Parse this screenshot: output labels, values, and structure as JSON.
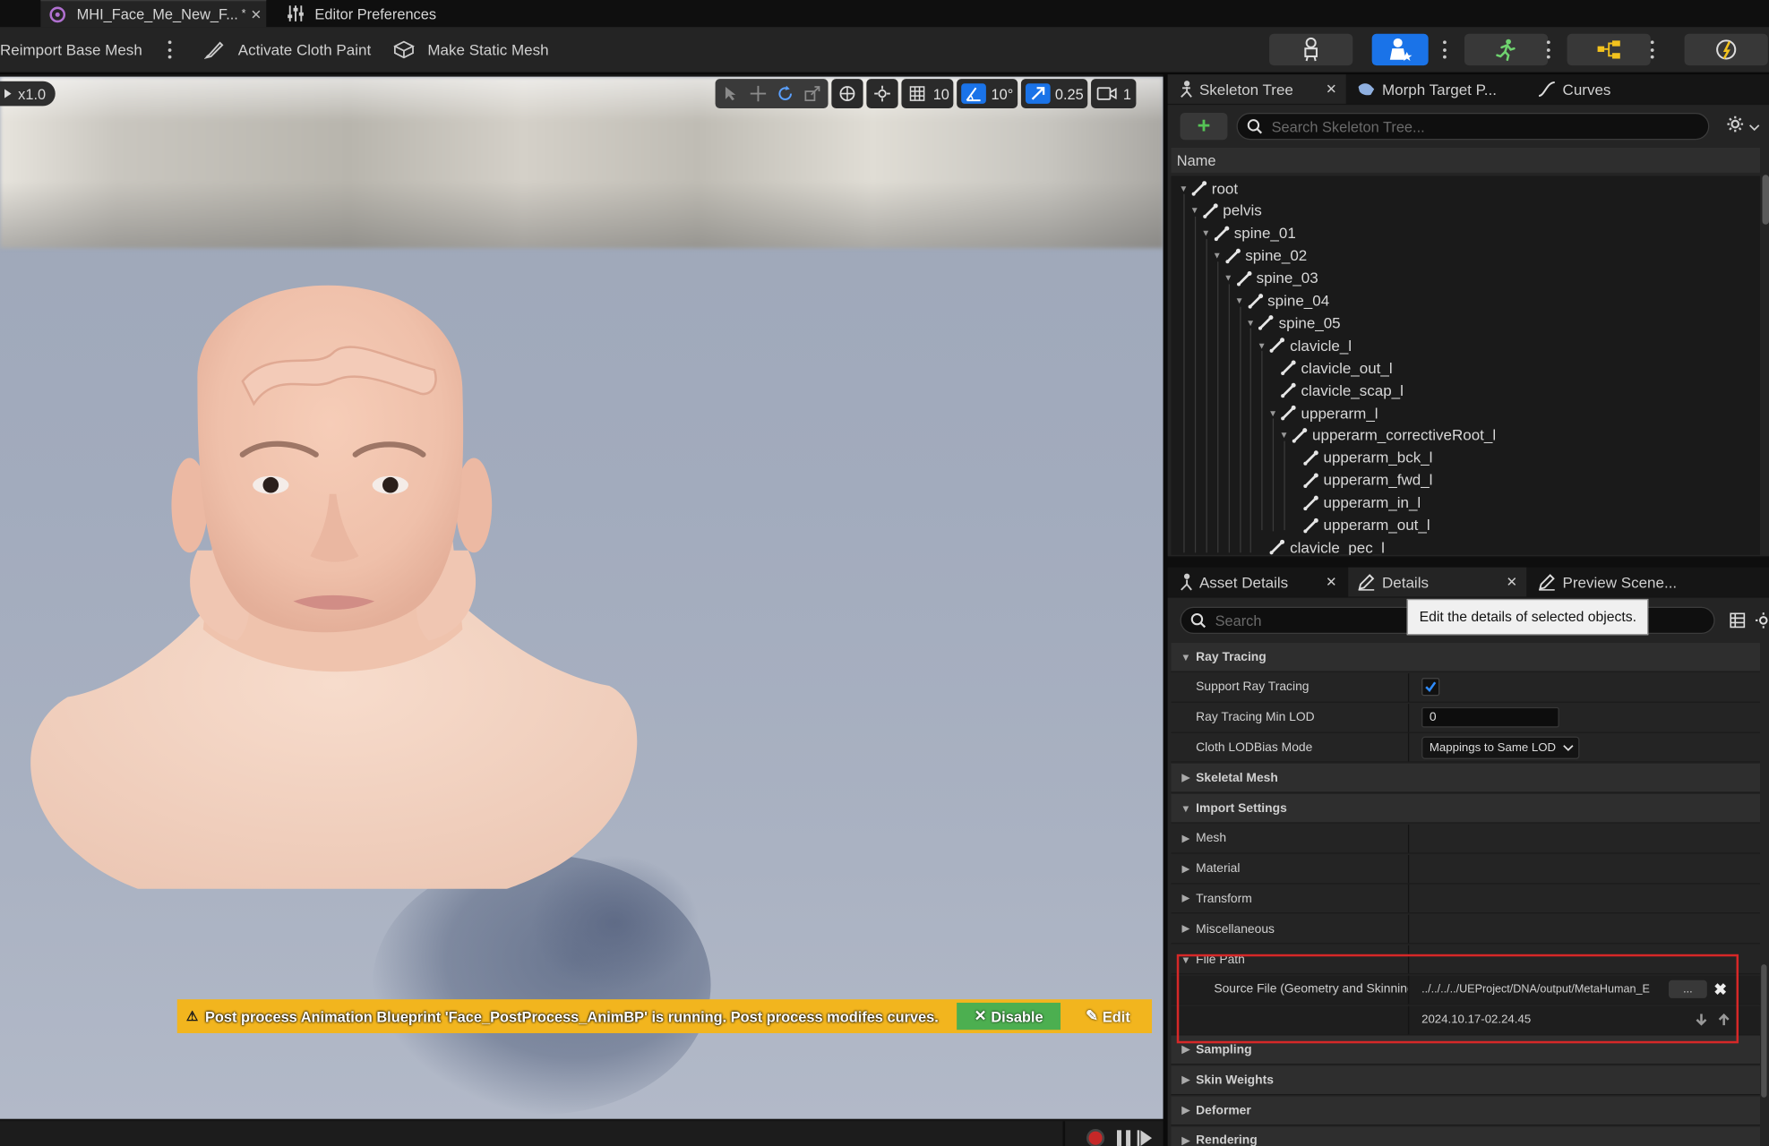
{
  "tabs": [
    {
      "label": "MHI_Face_Me_New_F...",
      "dirty": "*",
      "close": "✕"
    },
    {
      "label": "Editor Preferences"
    }
  ],
  "toolbar": {
    "reimport_label": "Reimport Base Mesh",
    "cloth_paint_label": "Activate Cloth Paint",
    "static_mesh_label": "Make Static Mesh"
  },
  "viewport": {
    "speed": "x1.0",
    "grid_snap": "10",
    "rotation_snap": "10°",
    "scale_snap": "0.25",
    "camera_speed": "1"
  },
  "notification": {
    "text": "Post process Animation Blueprint 'Face_PostProcess_AnimBP' is running. Post process modifes curves.",
    "disable_label": "Disable",
    "edit_label": "Edit"
  },
  "skeleton_panel": {
    "tabs": [
      "Skeleton Tree",
      "Morph Target P...",
      "Curves"
    ],
    "search_placeholder": "Search Skeleton Tree...",
    "column_name": "Name",
    "bones": [
      {
        "name": "root",
        "depth": 0,
        "expanded": true
      },
      {
        "name": "pelvis",
        "depth": 1,
        "expanded": true
      },
      {
        "name": "spine_01",
        "depth": 2,
        "expanded": true
      },
      {
        "name": "spine_02",
        "depth": 3,
        "expanded": true
      },
      {
        "name": "spine_03",
        "depth": 4,
        "expanded": true
      },
      {
        "name": "spine_04",
        "depth": 5,
        "expanded": true
      },
      {
        "name": "spine_05",
        "depth": 6,
        "expanded": true
      },
      {
        "name": "clavicle_l",
        "depth": 7,
        "expanded": true
      },
      {
        "name": "clavicle_out_l",
        "depth": 8,
        "expanded": false
      },
      {
        "name": "clavicle_scap_l",
        "depth": 8,
        "expanded": false
      },
      {
        "name": "upperarm_l",
        "depth": 8,
        "expanded": true
      },
      {
        "name": "upperarm_correctiveRoot_l",
        "depth": 9,
        "expanded": true
      },
      {
        "name": "upperarm_bck_l",
        "depth": 10,
        "expanded": false
      },
      {
        "name": "upperarm_fwd_l",
        "depth": 10,
        "expanded": false
      },
      {
        "name": "upperarm_in_l",
        "depth": 10,
        "expanded": false
      },
      {
        "name": "upperarm_out_l",
        "depth": 10,
        "expanded": false
      },
      {
        "name": "clavicle_pec_l",
        "depth": 7,
        "expanded": false
      }
    ]
  },
  "details_panel": {
    "tabs": [
      "Asset Details",
      "Details",
      "Preview Scene..."
    ],
    "search_placeholder": "Search",
    "tooltip": "Edit the details of selected objects.",
    "rows": [
      {
        "label": "Ray Tracing",
        "kind": "category",
        "expanded": true
      },
      {
        "label": "Support Ray Tracing",
        "kind": "checkbox",
        "checked": true
      },
      {
        "label": "Ray Tracing Min LOD",
        "kind": "number",
        "value": "0"
      },
      {
        "label": "Cloth LODBias Mode",
        "kind": "combo",
        "value": "Mappings to Same LOD"
      },
      {
        "label": "Skeletal Mesh",
        "kind": "category",
        "expanded": false
      },
      {
        "label": "Import Settings",
        "kind": "category",
        "expanded": true
      },
      {
        "label": "Mesh",
        "kind": "group"
      },
      {
        "label": "Material",
        "kind": "group"
      },
      {
        "label": "Transform",
        "kind": "group"
      },
      {
        "label": "Miscellaneous",
        "kind": "group"
      },
      {
        "label": "File Path",
        "kind": "group-open"
      },
      {
        "label": "Source File (Geometry and Skinning W",
        "kind": "path",
        "value": "../../../../UEProject/DNA/output/MetaHuman_E",
        "browse": "..."
      },
      {
        "label": "",
        "kind": "timestamp",
        "value": "2024.10.17-02.24.45"
      },
      {
        "label": "Sampling",
        "kind": "category",
        "expanded": false
      },
      {
        "label": "Skin Weights",
        "kind": "category",
        "expanded": false
      },
      {
        "label": "Deformer",
        "kind": "category",
        "expanded": false
      },
      {
        "label": "Rendering",
        "kind": "category",
        "expanded": false
      }
    ]
  },
  "colors": {
    "accent": "#1a73e8",
    "warning": "#f2b51e",
    "disable_green": "#4caf50",
    "highlight_red": "#d62828"
  }
}
